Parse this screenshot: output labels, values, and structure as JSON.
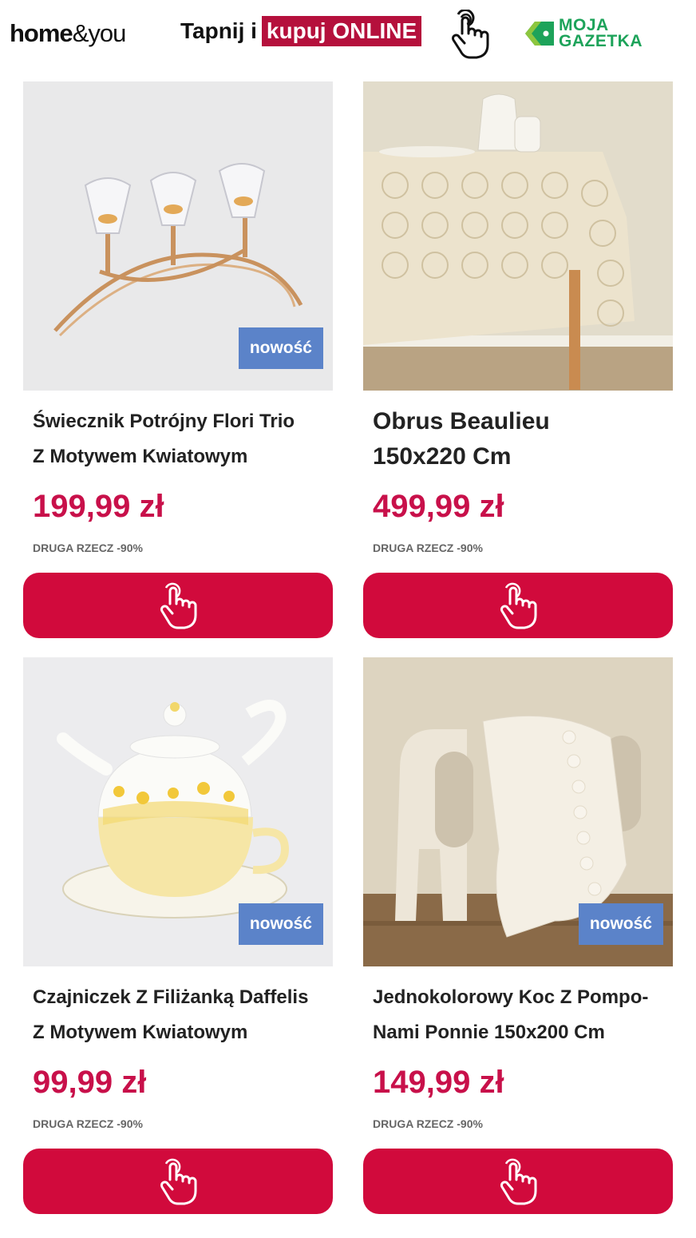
{
  "header": {
    "brand_bold": "home",
    "brand_amp": "&",
    "brand_you": "you",
    "promo_text": "Tapnij i",
    "promo_highlight": "kupuj ONLINE",
    "gazetka_line1": "MOJA",
    "gazetka_line2": "GAZETKA"
  },
  "colors": {
    "accent": "#d10a3c",
    "price": "#c8104a",
    "badge": "#5b83c9",
    "gazetka": "#1da35a"
  },
  "products": [
    {
      "title_line1": "Świecznik Potrójny Flori Trio",
      "title_line2": "Z Motywem Kwiatowym",
      "price": "199,99 zł",
      "note": "DRUGA RZECZ -90%",
      "badge": "nowość"
    },
    {
      "title_line1": "Obrus Beaulieu",
      "title_line2": "150x220 Cm",
      "price": "499,99 zł",
      "note": "DRUGA RZECZ -90%",
      "badge": ""
    },
    {
      "title_line1": "Czajniczek Z Filiżanką Daffelis",
      "title_line2": "Z Motywem Kwiatowym",
      "price": "99,99 zł",
      "note": "DRUGA RZECZ -90%",
      "badge": "nowość"
    },
    {
      "title_line1": "Jednokolorowy Koc Z Pompo-",
      "title_line2": "Nami Ponnie 150x200 Cm",
      "price": "149,99 zł",
      "note": "DRUGA RZECZ -90%",
      "badge": "nowość"
    }
  ],
  "icons": {
    "buy": "pointing-hand-icon",
    "promo": "pointing-hand-icon",
    "gazetka": "tag-icon"
  }
}
